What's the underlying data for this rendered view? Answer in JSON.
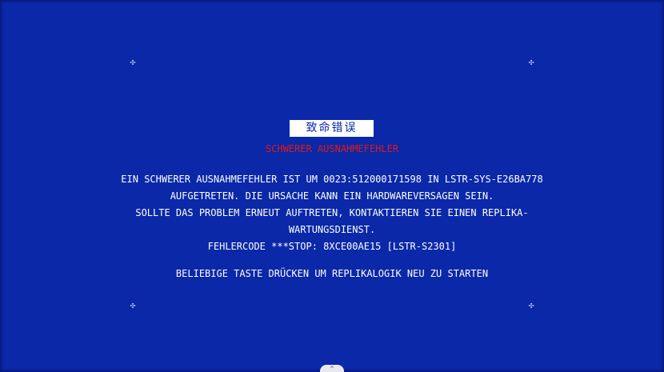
{
  "error_screen": {
    "title_box": "致命错误",
    "subtitle": "SCHWERER AUSNAHMEFEHLER",
    "body_lines": [
      "EIN SCHWERER AUSNAHMEFEHLER IST UM 0023:512000171598 IN LSTR-SYS-E26BA778",
      "AUFGETRETEN. DIE URSACHE KANN EIN HARDWAREVERSAGEN SEIN.",
      "SOLLTE DAS PROBLEM ERNEUT AUFTRETEN, KONTAKTIEREN SIE EINEN REPLIKA-",
      "WARTUNGSDIENST.",
      "FEHLERCODE ***STOP: 8XCE00AE15 [LSTR-S2301]"
    ],
    "prompt": "BELIEBIGE TASTE DRÜCKEN UM REPLIKALOGIK NEU ZU STARTEN"
  },
  "decorations": {
    "corner_marker_glyph": "✣",
    "tab_glyph": "⌃"
  },
  "colors": {
    "background": "#0a28a8",
    "text": "#ffffff",
    "subtitle": "#e01818",
    "title_box_bg": "#ffffff"
  },
  "icons": {
    "corner_markers": "crosshair-icon",
    "bottom_tab": "chevron-up-icon"
  }
}
